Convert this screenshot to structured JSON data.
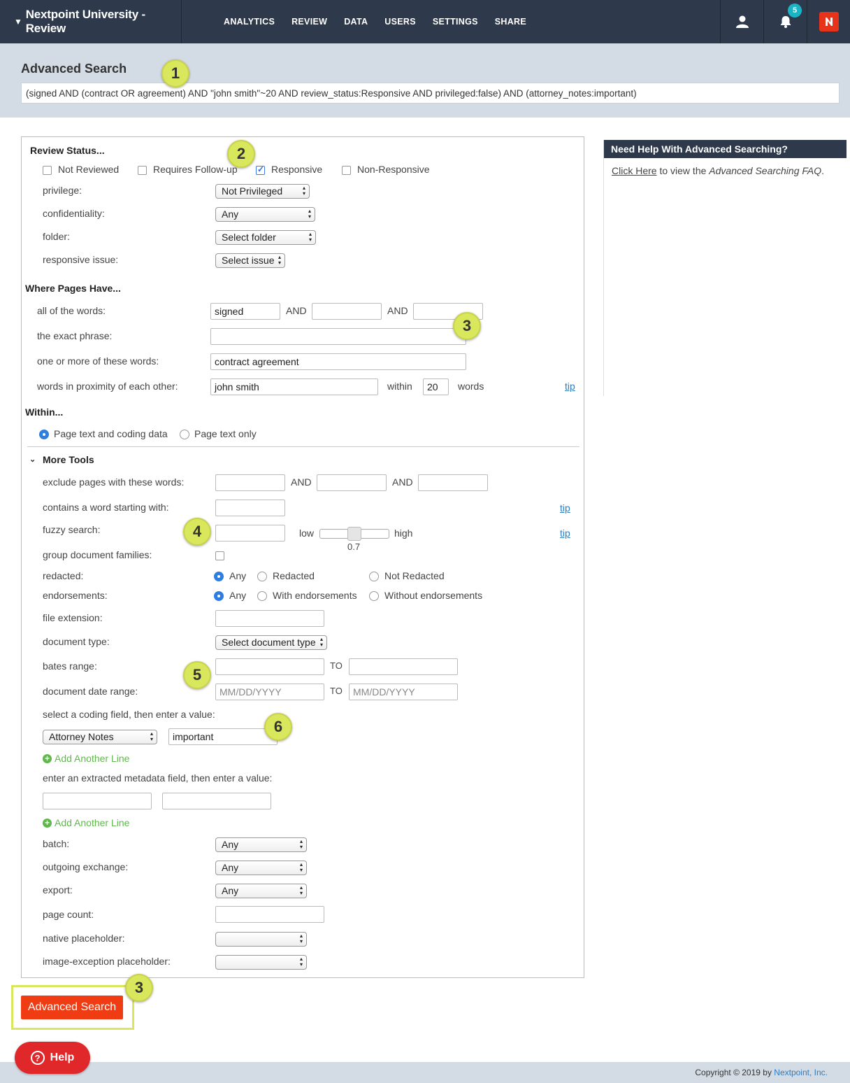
{
  "nav": {
    "app_title": "Nextpoint University - Review",
    "items": [
      "ANALYTICS",
      "REVIEW",
      "DATA",
      "USERS",
      "SETTINGS",
      "SHARE"
    ],
    "notification_count": "5"
  },
  "header": {
    "title": "Advanced Search",
    "query": "(signed AND (contract OR agreement) AND \"john smith\"~20 AND review_status:Responsive AND privileged:false) AND (attorney_notes:important)"
  },
  "review_status": {
    "heading": "Review Status...",
    "checkboxes": [
      {
        "label": "Not Reviewed",
        "checked": false
      },
      {
        "label": "Requires Follow-up",
        "checked": false
      },
      {
        "label": "Responsive",
        "checked": true
      },
      {
        "label": "Non-Responsive",
        "checked": false
      }
    ],
    "privilege_label": "privilege:",
    "privilege_value": "Not Privileged",
    "confidentiality_label": "confidentiality:",
    "confidentiality_value": "Any",
    "folder_label": "folder:",
    "folder_value": "Select folder",
    "issue_label": "responsive issue:",
    "issue_value": "Select issue"
  },
  "pages": {
    "heading": "Where Pages Have...",
    "all_words_label": "all of the words:",
    "all_words": [
      "signed",
      "",
      ""
    ],
    "and": "AND",
    "exact_phrase_label": "the exact phrase:",
    "exact_phrase": "",
    "one_or_more_label": "one or more of these words:",
    "one_or_more": "contract agreement",
    "proximity_label": "words in proximity of each other:",
    "proximity": "john smith",
    "within": "within",
    "within_value": "20",
    "words": "words",
    "tip": "tip"
  },
  "within": {
    "heading": "Within...",
    "options": [
      "Page text and coding data",
      "Page text only"
    ],
    "selected": "Page text and coding data"
  },
  "more_tools": {
    "heading": "More Tools",
    "exclude_label": "exclude pages with these words:",
    "starting_label": "contains a word starting with:",
    "fuzzy_label": "fuzzy search:",
    "fuzzy_low": "low",
    "fuzzy_high": "high",
    "fuzzy_value": "0.7",
    "fuzzy_level": 0.5,
    "group_label": "group document families:",
    "redacted_label": "redacted:",
    "redacted_options": [
      "Any",
      "Redacted",
      "Not Redacted"
    ],
    "endorse_label": "endorsements:",
    "endorse_options": [
      "Any",
      "With endorsements",
      "Without endorsements"
    ],
    "ext_label": "file extension:",
    "doctype_label": "document type:",
    "doctype_value": "Select document type",
    "bates_label": "bates range:",
    "to": "TO",
    "date_label": "document date range:",
    "date_placeholder": "MM/DD/YYYY",
    "coding_label": "select a coding field, then enter a value:",
    "coding_field": "Attorney Notes",
    "coding_value": "important",
    "add_line": "Add Another Line",
    "metadata_label": "enter an extracted metadata field, then enter a value:",
    "batch_label": "batch:",
    "batch_value": "Any",
    "outgoing_label": "outgoing exchange:",
    "outgoing_value": "Any",
    "export_label": "export:",
    "export_value": "Any",
    "pagecount_label": "page count:",
    "native_label": "native placeholder:",
    "image_label": "image-exception placeholder:"
  },
  "sidebar": {
    "title": "Need Help With Advanced Searching?",
    "link": "Click Here",
    "text_mid": " to view the ",
    "text_em": "Advanced Searching FAQ",
    "text_end": "."
  },
  "markers": [
    "1",
    "2",
    "3",
    "4",
    "5",
    "6",
    "3"
  ],
  "buttons": {
    "search": "Advanced Search",
    "help": "Help"
  },
  "footer": {
    "copyright": "Copyright © 2019 by ",
    "company": "Nextpoint, Inc."
  }
}
